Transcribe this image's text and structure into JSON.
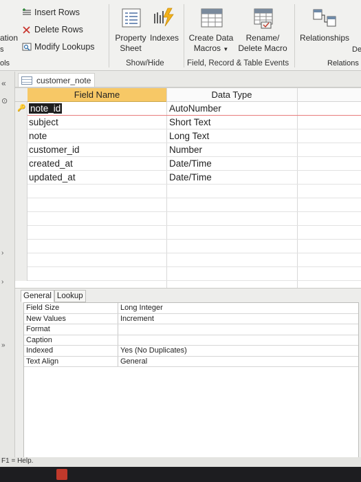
{
  "ribbon": {
    "insert_rows": "Insert Rows",
    "delete_rows": "Delete Rows",
    "modify_lookups": "Modify Lookups",
    "property_sheet_line1": "Property",
    "property_sheet_line2": "Sheet",
    "indexes": "Indexes",
    "create_data_macros_line1": "Create Data",
    "create_data_macros_line2": "Macros",
    "rename_delete_macro_line1": "Rename/",
    "rename_delete_macro_line2": "Delete Macro",
    "relationships": "Relationships",
    "group_show_hide": "Show/Hide",
    "group_field_record_events": "Field, Record & Table Events",
    "edge_left_1": "ation",
    "edge_left_2": "s",
    "edge_left_3": "ols",
    "edge_right_1": "De",
    "edge_right_2": "Relations"
  },
  "left_nav": {
    "collapse_glyph": "«"
  },
  "object_tab": {
    "label": "customer_note"
  },
  "grid": {
    "header_field_name": "Field Name",
    "header_data_type": "Data Type",
    "rows": [
      {
        "field": "note_id",
        "type": "AutoNumber"
      },
      {
        "field": "subject",
        "type": "Short Text"
      },
      {
        "field": "note",
        "type": "Long Text"
      },
      {
        "field": "customer_id",
        "type": "Number"
      },
      {
        "field": "created_at",
        "type": "Date/Time"
      },
      {
        "field": "updated_at",
        "type": "Date/Time"
      }
    ]
  },
  "properties": {
    "tab_general": "General",
    "tab_lookup": "Lookup",
    "rows": [
      {
        "name": "Field Size",
        "value": "Long Integer"
      },
      {
        "name": "New Values",
        "value": "Increment"
      },
      {
        "name": "Format",
        "value": ""
      },
      {
        "name": "Caption",
        "value": ""
      },
      {
        "name": "Indexed",
        "value": "Yes (No Duplicates)"
      },
      {
        "name": "Text Align",
        "value": "General"
      }
    ]
  },
  "status": {
    "text": "F1 = Help."
  },
  "colors": {
    "header_accent": "#f7c866",
    "selection": "#1e1e1e",
    "active_row_border": "#e87b7b"
  }
}
